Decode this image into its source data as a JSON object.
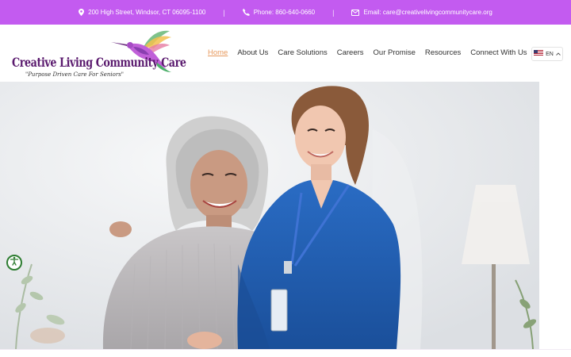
{
  "topbar": {
    "address": "200 High Street, Windsor, CT 06095-1100",
    "phone": "Phone: 860-640-0660",
    "email": "Email: care@creativelivingcommunitycare.org",
    "separator": "|"
  },
  "logo": {
    "title": "Creative Living Community Care",
    "tagline": "\"Purpose Driven Care For Seniors\""
  },
  "nav": {
    "items": [
      "Home",
      "About Us",
      "Care Solutions",
      "Careers",
      "Our Promise",
      "Resources",
      "Connect With Us"
    ],
    "active": "Home"
  },
  "language": {
    "code": "EN"
  },
  "colors": {
    "topbar": "#c35bf0",
    "nav_active": "#e79a5e",
    "logo_text": "#5a1a6e",
    "scrubs": "#1f5fb8",
    "accessibility": "#2e7d32"
  },
  "icons": [
    "location-pin-icon",
    "phone-icon",
    "email-icon",
    "us-flag-icon",
    "chevron-up-icon",
    "accessibility-icon",
    "hummingbird-logo"
  ]
}
